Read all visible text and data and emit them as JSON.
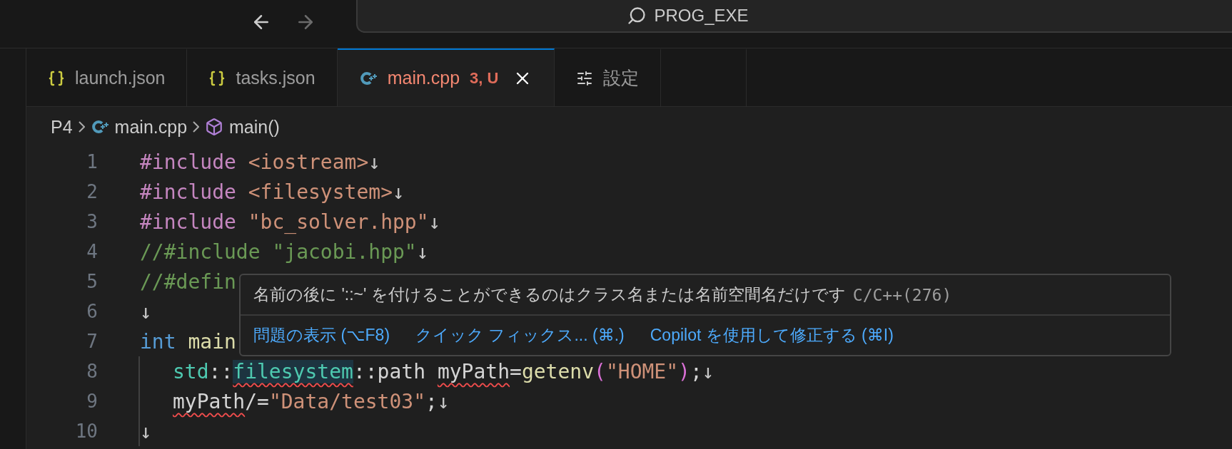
{
  "title_bar": {
    "search": "PROG_EXE"
  },
  "tabs": [
    {
      "label": "launch.json",
      "kind": "braces",
      "selected": false,
      "error": false
    },
    {
      "label": "tasks.json",
      "kind": "braces",
      "selected": false,
      "error": false
    },
    {
      "label": "main.cpp",
      "kind": "cpp",
      "selected": true,
      "error": true,
      "badge": "3, U"
    },
    {
      "label": "設定",
      "kind": "settings",
      "selected": false,
      "error": false
    }
  ],
  "breadcrumb": [
    {
      "label": "P4",
      "kind": "folder"
    },
    {
      "label": "main.cpp",
      "kind": "cpp"
    },
    {
      "label": "main()",
      "kind": "cube"
    }
  ],
  "lines": [
    {
      "number": "1",
      "guide": false,
      "indent": false,
      "tokens": [
        {
          "text": "#include",
          "kind": "keyword",
          "error": false,
          "highlighted": false
        },
        {
          "text": " <iostream>",
          "kind": "string",
          "error": false,
          "highlighted": false
        },
        {
          "text": "↓",
          "kind": "eol",
          "error": false,
          "highlighted": false
        }
      ]
    },
    {
      "number": "2",
      "guide": false,
      "indent": false,
      "tokens": [
        {
          "text": "#include",
          "kind": "keyword",
          "error": false,
          "highlighted": false
        },
        {
          "text": " <filesystem>",
          "kind": "string",
          "error": false,
          "highlighted": false
        },
        {
          "text": "↓",
          "kind": "eol",
          "error": false,
          "highlighted": false
        }
      ]
    },
    {
      "number": "3",
      "guide": false,
      "indent": false,
      "tokens": [
        {
          "text": "#include",
          "kind": "keyword",
          "error": false,
          "highlighted": false
        },
        {
          "text": " \"bc_solver.hpp\"",
          "kind": "string",
          "error": false,
          "highlighted": false
        },
        {
          "text": "↓",
          "kind": "eol",
          "error": false,
          "highlighted": false
        }
      ]
    },
    {
      "number": "4",
      "guide": false,
      "indent": false,
      "tokens": [
        {
          "text": "//#include",
          "kind": "comment",
          "error": false,
          "highlighted": false
        },
        {
          "text": " \"jacobi.hpp\"",
          "kind": "comment",
          "error": false,
          "highlighted": false
        },
        {
          "text": "↓",
          "kind": "eol",
          "error": false,
          "highlighted": false
        }
      ]
    },
    {
      "number": "5",
      "guide": false,
      "indent": false,
      "tokens": [
        {
          "text": "//#defin",
          "kind": "comment",
          "error": false,
          "highlighted": false
        }
      ]
    },
    {
      "number": "6",
      "guide": false,
      "indent": false,
      "tokens": [
        {
          "text": "↓",
          "kind": "eol",
          "error": false,
          "highlighted": false
        }
      ]
    },
    {
      "number": "7",
      "guide": false,
      "indent": false,
      "tokens": [
        {
          "text": "int",
          "kind": "type-keyword",
          "error": false,
          "highlighted": false
        },
        {
          "text": " main",
          "kind": "function",
          "error": false,
          "highlighted": false
        }
      ]
    },
    {
      "number": "8",
      "guide": true,
      "indent": true,
      "tokens": [
        {
          "text": "std",
          "kind": "type",
          "error": false,
          "highlighted": false
        },
        {
          "text": "::",
          "kind": "plain",
          "error": false,
          "highlighted": false
        },
        {
          "text": "filesystem",
          "kind": "type",
          "error": true,
          "highlighted": true
        },
        {
          "text": "::path ",
          "kind": "plain",
          "error": false,
          "highlighted": false
        },
        {
          "text": "myPath",
          "kind": "plain",
          "error": true,
          "highlighted": false
        },
        {
          "text": "=",
          "kind": "plain",
          "error": false,
          "highlighted": false
        },
        {
          "text": "getenv",
          "kind": "function",
          "error": false,
          "highlighted": false
        },
        {
          "text": "(",
          "kind": "bracket",
          "error": false,
          "highlighted": false
        },
        {
          "text": "\"HOME\"",
          "kind": "string",
          "error": false,
          "highlighted": false
        },
        {
          "text": ")",
          "kind": "bracket",
          "error": false,
          "highlighted": false
        },
        {
          "text": ";",
          "kind": "plain",
          "error": false,
          "highlighted": false
        },
        {
          "text": "↓",
          "kind": "eol",
          "error": false,
          "highlighted": false
        }
      ]
    },
    {
      "number": "9",
      "guide": true,
      "indent": true,
      "tokens": [
        {
          "text": "myPath",
          "kind": "plain",
          "error": true,
          "highlighted": false
        },
        {
          "text": "/=",
          "kind": "plain",
          "error": false,
          "highlighted": false
        },
        {
          "text": "\"Data/test03\"",
          "kind": "string",
          "error": false,
          "highlighted": false
        },
        {
          "text": ";",
          "kind": "plain",
          "error": false,
          "highlighted": false
        },
        {
          "text": "↓",
          "kind": "eol",
          "error": false,
          "highlighted": false
        }
      ]
    },
    {
      "number": "10",
      "guide": true,
      "indent": false,
      "tokens": [
        {
          "text": "↓",
          "kind": "eol",
          "error": false,
          "highlighted": false
        }
      ]
    }
  ],
  "hover": {
    "message": "名前の後に '::~' を付けることができるのはクラス名または名前空間名だけです",
    "source": "C/C++(276)",
    "actions": [
      "問題の表示 (⌥F8)",
      "クイック フィックス... (⌘.)",
      "Copilot を使用して修正する (⌘I)"
    ]
  }
}
